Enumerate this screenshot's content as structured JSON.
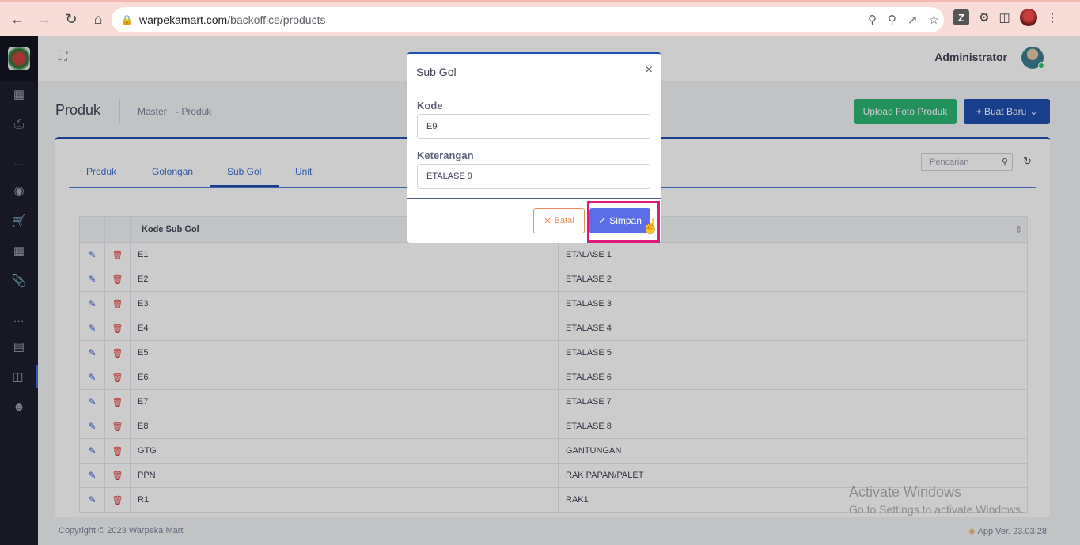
{
  "browser": {
    "url_host": "warpekamart.com",
    "url_path": "/backoffice/products"
  },
  "header": {
    "admin_name": "Administrator"
  },
  "subheader": {
    "title": "Produk",
    "breadcrumb": [
      "Master",
      "- Produk"
    ],
    "upload_button": "Upload Foto Produk",
    "new_button": "+ Buat Baru"
  },
  "tabs": [
    {
      "label": "Produk"
    },
    {
      "label": "Golongan"
    },
    {
      "label": "Sub Gol"
    },
    {
      "label": "Unit"
    }
  ],
  "search": {
    "placeholder": "Pencarian"
  },
  "table": {
    "headers": [
      "Kode Sub Gol"
    ],
    "rows": [
      {
        "kode": "E1",
        "keterangan": "ETALASE 1"
      },
      {
        "kode": "E2",
        "keterangan": "ETALASE 2"
      },
      {
        "kode": "E3",
        "keterangan": "ETALASE 3"
      },
      {
        "kode": "E4",
        "keterangan": "ETALASE 4"
      },
      {
        "kode": "E5",
        "keterangan": "ETALASE 5"
      },
      {
        "kode": "E6",
        "keterangan": "ETALASE 6"
      },
      {
        "kode": "E7",
        "keterangan": "ETALASE 7"
      },
      {
        "kode": "E8",
        "keterangan": "ETALASE 8"
      },
      {
        "kode": "GTG",
        "keterangan": "GANTUNGAN"
      },
      {
        "kode": "PPN",
        "keterangan": "RAK PAPAN/PALET"
      },
      {
        "kode": "R1",
        "keterangan": "RAK1"
      }
    ]
  },
  "footer": {
    "copyright": "Copyright © 2023 Warpeka Mart",
    "app_version": "App Ver. 23.03.28"
  },
  "modal": {
    "title": "Sub Gol",
    "close": "×",
    "kode_label": "Kode",
    "kode_value": "E9",
    "keterangan_label": "Keterangan",
    "keterangan_value": "ETALASE 9",
    "cancel_label": "Batal",
    "save_label": "Simpan"
  },
  "watermark": {
    "title": "Activate Windows",
    "subtitle": "Go to Settings to activate Windows."
  },
  "colors": {
    "primary": "#1f4fb0",
    "success": "#2bb673",
    "save": "#5b6ee8",
    "cancel": "#f08c5a",
    "highlight": "#e0197d"
  },
  "icons": [
    "back-icon",
    "forward-icon",
    "reload-icon",
    "home-icon",
    "lock-icon",
    "key-icon",
    "zoom-icon",
    "share-icon",
    "star-icon",
    "extension-icon",
    "sidepanel-icon",
    "menu-icon",
    "expand-icon",
    "edit-icon",
    "trash-icon",
    "refresh-icon",
    "search-icon",
    "close-icon",
    "check-icon",
    "cursor-icon"
  ]
}
